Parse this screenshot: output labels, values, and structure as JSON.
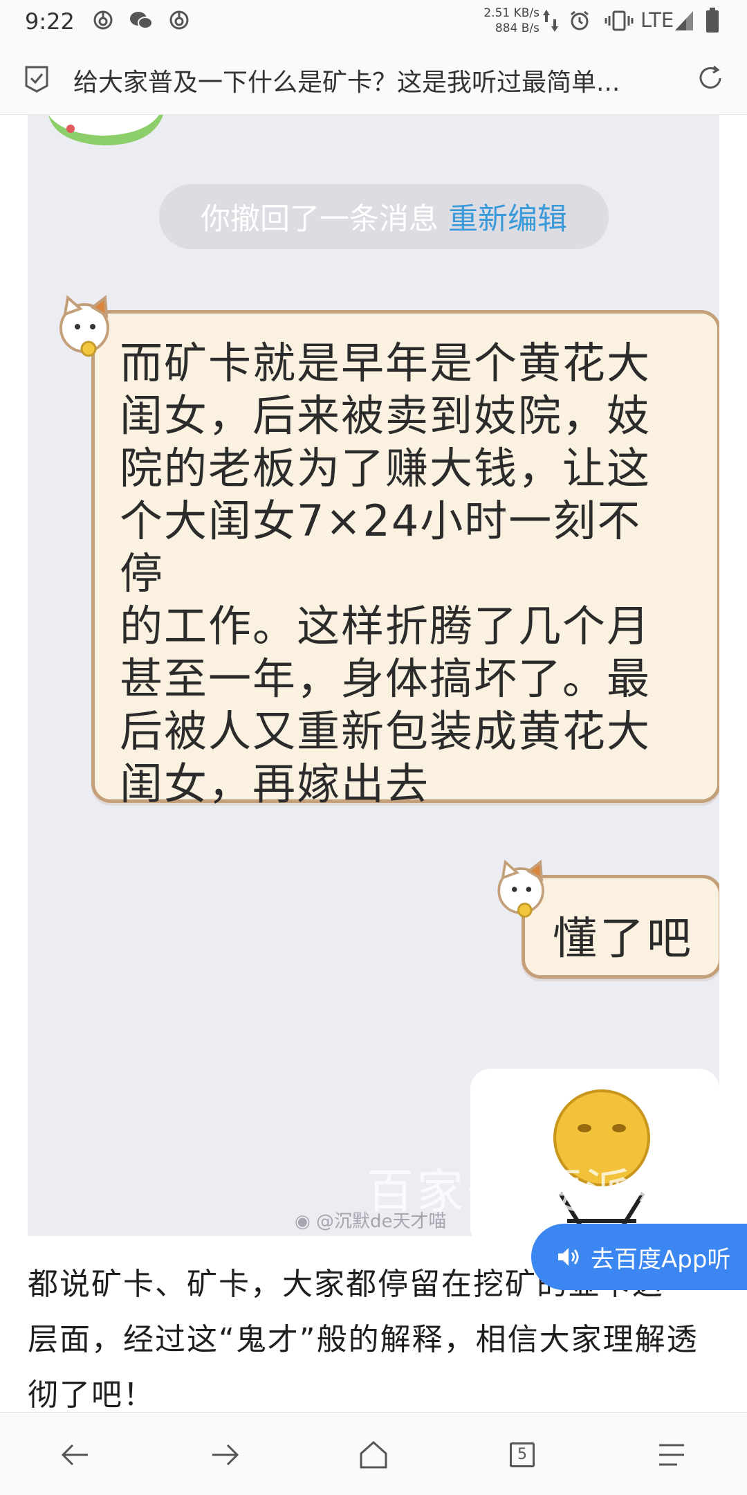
{
  "status_bar": {
    "time": "9:22",
    "net_speed_up": "2.51 KB/s",
    "net_speed_down": "884 B/s",
    "network": "LTE",
    "icons": [
      "netease-music-icon",
      "wechat-icon",
      "netease-music-icon",
      "data-arrows-icon",
      "alarm-icon",
      "vibrate-icon",
      "signal-icon",
      "battery-icon"
    ]
  },
  "title_bar": {
    "title": "给大家普及一下什么是矿卡？这是我听过最简单...",
    "icons": [
      "bookmark-check-icon",
      "refresh-icon"
    ]
  },
  "chat_image": {
    "recall_text": "你撤回了一条消息",
    "recall_link": "重新编辑",
    "message_main_lines": [
      "而矿卡就是早年是个黄花大",
      "闺女，后来被卖到妓院，妓",
      "院的老板为了赚大钱，让这",
      "个大闺女7×24小时一刻不停",
      "的工作。这样折腾了几个月",
      "甚至一年，身体搞坏了。最",
      "后被人又重新包装成黄花大",
      "闺女，再嫁出去"
    ],
    "message_reply": "懂了吧",
    "watermark": "百家号/硬派数码",
    "weibo_mark": "@沉默de天才喵"
  },
  "article": {
    "paragraph": "都说矿卡、矿卡，大家都停留在挖矿的显卡这一层面，经过这“鬼才”般的解释，相信大家理解透彻了吧！"
  },
  "listen_button": {
    "label": "去百度App听",
    "icon": "speaker-icon"
  },
  "bottom_nav": {
    "tab_count": "5",
    "icons": [
      "back-arrow-icon",
      "forward-arrow-icon",
      "home-icon",
      "tabs-icon",
      "menu-icon"
    ]
  },
  "colors": {
    "accent_blue": "#3b86f0",
    "recall_link": "#3a9ad9",
    "bubble_fill": "#fbf1e0",
    "bubble_border": "#c4a07a"
  }
}
